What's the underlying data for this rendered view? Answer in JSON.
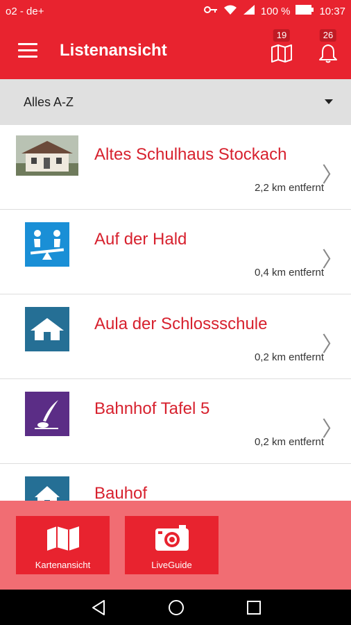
{
  "status": {
    "carrier": "o2 - de+",
    "battery_text": "100 %",
    "time": "10:37"
  },
  "appbar": {
    "title": "Listenansicht",
    "map_count": "19",
    "notify_count": "26"
  },
  "sort": {
    "label": "Alles A-Z"
  },
  "items": [
    {
      "name": "Altes Schulhaus Stockach",
      "distance": "2,2 km entfernt"
    },
    {
      "name": "Auf der Hald",
      "distance": "0,4 km entfernt"
    },
    {
      "name": "Aula der Schlossschule",
      "distance": "0,2 km entfernt"
    },
    {
      "name": "Bahnhof Tafel 5",
      "distance": "0,2 km entfernt"
    },
    {
      "name": "Bauhof",
      "distance": ""
    }
  ],
  "footer": {
    "map_label": "Kartenansicht",
    "live_label": "LiveGuide"
  },
  "colors": {
    "brand": "#e8232f",
    "footer": "#f16d73",
    "tile_blue": "#1a8fd6",
    "tile_teal": "#256f95",
    "tile_purple": "#5b2d86"
  },
  "icons": [
    "menu-icon",
    "map-icon",
    "bell-icon",
    "wifi-icon",
    "signal-icon",
    "battery-icon",
    "key-icon",
    "playground-icon",
    "house-icon",
    "quill-icon",
    "camera-icon",
    "back-icon",
    "home-icon",
    "recents-icon"
  ]
}
